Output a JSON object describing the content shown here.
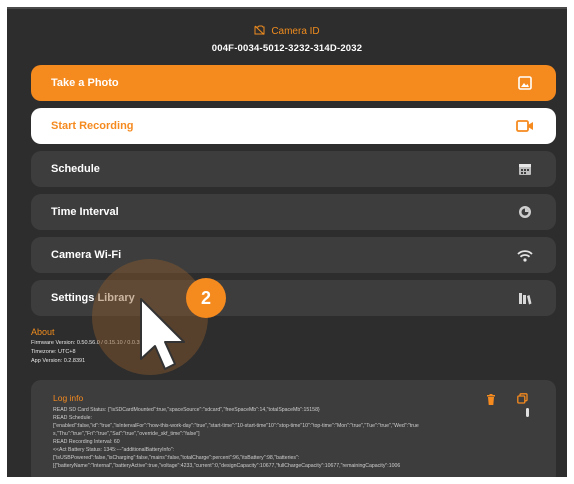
{
  "header": {
    "title": "Camera ID",
    "camera_id": "004F-0034-5012-3232-314D-2032"
  },
  "menu": [
    {
      "label": "Take a Photo",
      "icon": "photo-icon"
    },
    {
      "label": "Start Recording",
      "icon": "video-camera-icon"
    },
    {
      "label": "Schedule",
      "icon": "calendar-icon"
    },
    {
      "label": "Time Interval",
      "icon": "timer-icon"
    },
    {
      "label": "Camera Wi-Fi",
      "icon": "wifi-icon"
    },
    {
      "label": "Settings Library",
      "icon": "library-icon"
    }
  ],
  "about": {
    "title": "About",
    "firmware": "Firmware Version: 0.50.56.0 / 0.15.10 / 0.0.3504",
    "timezone": "Timezone: UTC+8",
    "app_version": "App Version: 0.2.8391"
  },
  "log": {
    "title": "Log info",
    "lines": [
      "READ SD Card Status: {\"isSDCardMounted\":true,\"spaceSource\":\"sdcard\",\"freeSpaceMb\":14,\"totalSpaceMb\":15158}",
      "READ Schedule:",
      "[\"enabled\":false,\"id\":\"true\",\"isIntervalFor\":\"how-this-work-day\":\"true\",\"start-time\":\"10-start-time\"10\":\"stop-time\"10\":\"top-time\":\"Mon\":\"true\",\"Tue\":\"true\",\"Wed\":\"true",
      "s,\"Thu\":\"true\",\"Fri\":\"true\",\"Sat\":\"true\",\"override_skf_time\":\"false\"]",
      "READ Recording Interval: 60",
      "<<Act Battery Status: 1345:---\"additionalBatteryInfo\":",
      "[\"isUSBPowered\":false,\"isCharging\":false,\"mains\":false,\"totalCharge\":percent\":96,\"itsBattery\":98,\"batteries\":",
      "[{\"batteryName\":\"Internal\",\"batteryActive\":true,\"voltage\":4233,\"current\":0,\"designCapacity\":10677,\"fullChargeCapacity\":10677,\"remainingCapacity\":1006"
    ]
  },
  "annotation": {
    "step": "2"
  },
  "colors": {
    "accent": "#f58a1f",
    "background": "#2d2d2d",
    "button": "#3d3d3d"
  }
}
